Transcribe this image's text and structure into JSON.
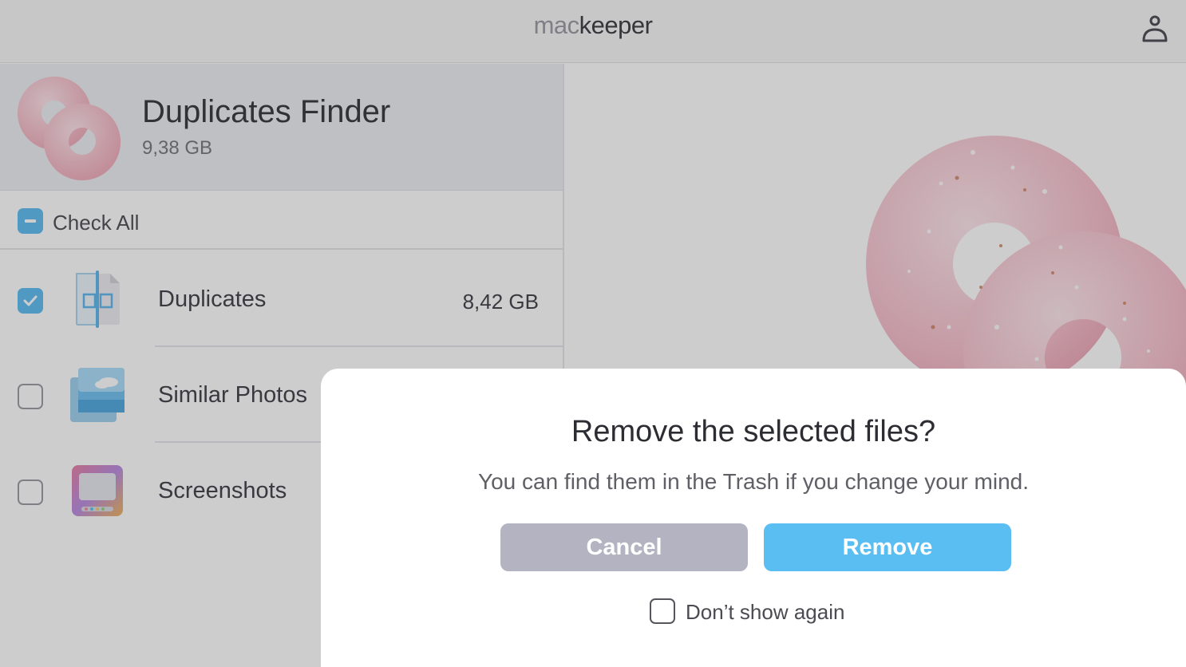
{
  "brand": {
    "prefix": "mac",
    "suffix": "keeper"
  },
  "header": {
    "title": "Duplicates Finder",
    "size": "9,38 GB"
  },
  "check_all": {
    "label": "Check All",
    "state": "partial"
  },
  "categories": [
    {
      "label": "Duplicates",
      "size": "8,42 GB",
      "checked": true,
      "icon": "duplicate-file-icon"
    },
    {
      "label": "Similar Photos",
      "size": "",
      "checked": false,
      "icon": "photo-stack-icon"
    },
    {
      "label": "Screenshots",
      "size": "",
      "checked": false,
      "icon": "screenshot-icon"
    }
  ],
  "dialog": {
    "title": "Remove the selected files?",
    "subtitle": "You can find them in the Trash if you change your mind.",
    "cancel_label": "Cancel",
    "remove_label": "Remove",
    "dont_show_label": "Don’t show again",
    "dont_show_checked": false
  },
  "colors": {
    "accent": "#5bbef2",
    "cancel": "#b3b3c1",
    "donut": "#f4c2cc"
  }
}
